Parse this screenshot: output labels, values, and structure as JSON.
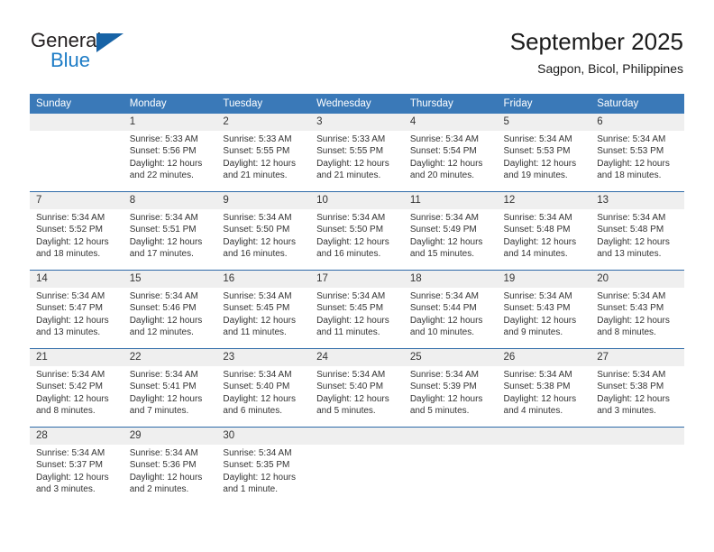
{
  "brand": {
    "name_top": "General",
    "name_bottom": "Blue",
    "triangle_color": "#1763a6",
    "blue_color": "#1d7cc6"
  },
  "header": {
    "title": "September 2025",
    "subtitle": "Sagpon, Bicol, Philippines"
  },
  "theme": {
    "header_blue": "#3a79b8",
    "divider_blue": "#2e6aa8",
    "daynum_band": "#efefef",
    "text": "#333333"
  },
  "weekdays": [
    "Sunday",
    "Monday",
    "Tuesday",
    "Wednesday",
    "Thursday",
    "Friday",
    "Saturday"
  ],
  "weeks": [
    [
      {
        "day": "",
        "sunrise": "",
        "sunset": "",
        "daylight1": "",
        "daylight2": ""
      },
      {
        "day": "1",
        "sunrise": "Sunrise: 5:33 AM",
        "sunset": "Sunset: 5:56 PM",
        "daylight1": "Daylight: 12 hours",
        "daylight2": "and 22 minutes."
      },
      {
        "day": "2",
        "sunrise": "Sunrise: 5:33 AM",
        "sunset": "Sunset: 5:55 PM",
        "daylight1": "Daylight: 12 hours",
        "daylight2": "and 21 minutes."
      },
      {
        "day": "3",
        "sunrise": "Sunrise: 5:33 AM",
        "sunset": "Sunset: 5:55 PM",
        "daylight1": "Daylight: 12 hours",
        "daylight2": "and 21 minutes."
      },
      {
        "day": "4",
        "sunrise": "Sunrise: 5:34 AM",
        "sunset": "Sunset: 5:54 PM",
        "daylight1": "Daylight: 12 hours",
        "daylight2": "and 20 minutes."
      },
      {
        "day": "5",
        "sunrise": "Sunrise: 5:34 AM",
        "sunset": "Sunset: 5:53 PM",
        "daylight1": "Daylight: 12 hours",
        "daylight2": "and 19 minutes."
      },
      {
        "day": "6",
        "sunrise": "Sunrise: 5:34 AM",
        "sunset": "Sunset: 5:53 PM",
        "daylight1": "Daylight: 12 hours",
        "daylight2": "and 18 minutes."
      }
    ],
    [
      {
        "day": "7",
        "sunrise": "Sunrise: 5:34 AM",
        "sunset": "Sunset: 5:52 PM",
        "daylight1": "Daylight: 12 hours",
        "daylight2": "and 18 minutes."
      },
      {
        "day": "8",
        "sunrise": "Sunrise: 5:34 AM",
        "sunset": "Sunset: 5:51 PM",
        "daylight1": "Daylight: 12 hours",
        "daylight2": "and 17 minutes."
      },
      {
        "day": "9",
        "sunrise": "Sunrise: 5:34 AM",
        "sunset": "Sunset: 5:50 PM",
        "daylight1": "Daylight: 12 hours",
        "daylight2": "and 16 minutes."
      },
      {
        "day": "10",
        "sunrise": "Sunrise: 5:34 AM",
        "sunset": "Sunset: 5:50 PM",
        "daylight1": "Daylight: 12 hours",
        "daylight2": "and 16 minutes."
      },
      {
        "day": "11",
        "sunrise": "Sunrise: 5:34 AM",
        "sunset": "Sunset: 5:49 PM",
        "daylight1": "Daylight: 12 hours",
        "daylight2": "and 15 minutes."
      },
      {
        "day": "12",
        "sunrise": "Sunrise: 5:34 AM",
        "sunset": "Sunset: 5:48 PM",
        "daylight1": "Daylight: 12 hours",
        "daylight2": "and 14 minutes."
      },
      {
        "day": "13",
        "sunrise": "Sunrise: 5:34 AM",
        "sunset": "Sunset: 5:48 PM",
        "daylight1": "Daylight: 12 hours",
        "daylight2": "and 13 minutes."
      }
    ],
    [
      {
        "day": "14",
        "sunrise": "Sunrise: 5:34 AM",
        "sunset": "Sunset: 5:47 PM",
        "daylight1": "Daylight: 12 hours",
        "daylight2": "and 13 minutes."
      },
      {
        "day": "15",
        "sunrise": "Sunrise: 5:34 AM",
        "sunset": "Sunset: 5:46 PM",
        "daylight1": "Daylight: 12 hours",
        "daylight2": "and 12 minutes."
      },
      {
        "day": "16",
        "sunrise": "Sunrise: 5:34 AM",
        "sunset": "Sunset: 5:45 PM",
        "daylight1": "Daylight: 12 hours",
        "daylight2": "and 11 minutes."
      },
      {
        "day": "17",
        "sunrise": "Sunrise: 5:34 AM",
        "sunset": "Sunset: 5:45 PM",
        "daylight1": "Daylight: 12 hours",
        "daylight2": "and 11 minutes."
      },
      {
        "day": "18",
        "sunrise": "Sunrise: 5:34 AM",
        "sunset": "Sunset: 5:44 PM",
        "daylight1": "Daylight: 12 hours",
        "daylight2": "and 10 minutes."
      },
      {
        "day": "19",
        "sunrise": "Sunrise: 5:34 AM",
        "sunset": "Sunset: 5:43 PM",
        "daylight1": "Daylight: 12 hours",
        "daylight2": "and 9 minutes."
      },
      {
        "day": "20",
        "sunrise": "Sunrise: 5:34 AM",
        "sunset": "Sunset: 5:43 PM",
        "daylight1": "Daylight: 12 hours",
        "daylight2": "and 8 minutes."
      }
    ],
    [
      {
        "day": "21",
        "sunrise": "Sunrise: 5:34 AM",
        "sunset": "Sunset: 5:42 PM",
        "daylight1": "Daylight: 12 hours",
        "daylight2": "and 8 minutes."
      },
      {
        "day": "22",
        "sunrise": "Sunrise: 5:34 AM",
        "sunset": "Sunset: 5:41 PM",
        "daylight1": "Daylight: 12 hours",
        "daylight2": "and 7 minutes."
      },
      {
        "day": "23",
        "sunrise": "Sunrise: 5:34 AM",
        "sunset": "Sunset: 5:40 PM",
        "daylight1": "Daylight: 12 hours",
        "daylight2": "and 6 minutes."
      },
      {
        "day": "24",
        "sunrise": "Sunrise: 5:34 AM",
        "sunset": "Sunset: 5:40 PM",
        "daylight1": "Daylight: 12 hours",
        "daylight2": "and 5 minutes."
      },
      {
        "day": "25",
        "sunrise": "Sunrise: 5:34 AM",
        "sunset": "Sunset: 5:39 PM",
        "daylight1": "Daylight: 12 hours",
        "daylight2": "and 5 minutes."
      },
      {
        "day": "26",
        "sunrise": "Sunrise: 5:34 AM",
        "sunset": "Sunset: 5:38 PM",
        "daylight1": "Daylight: 12 hours",
        "daylight2": "and 4 minutes."
      },
      {
        "day": "27",
        "sunrise": "Sunrise: 5:34 AM",
        "sunset": "Sunset: 5:38 PM",
        "daylight1": "Daylight: 12 hours",
        "daylight2": "and 3 minutes."
      }
    ],
    [
      {
        "day": "28",
        "sunrise": "Sunrise: 5:34 AM",
        "sunset": "Sunset: 5:37 PM",
        "daylight1": "Daylight: 12 hours",
        "daylight2": "and 3 minutes."
      },
      {
        "day": "29",
        "sunrise": "Sunrise: 5:34 AM",
        "sunset": "Sunset: 5:36 PM",
        "daylight1": "Daylight: 12 hours",
        "daylight2": "and 2 minutes."
      },
      {
        "day": "30",
        "sunrise": "Sunrise: 5:34 AM",
        "sunset": "Sunset: 5:35 PM",
        "daylight1": "Daylight: 12 hours",
        "daylight2": "and 1 minute."
      },
      {
        "day": "",
        "sunrise": "",
        "sunset": "",
        "daylight1": "",
        "daylight2": ""
      },
      {
        "day": "",
        "sunrise": "",
        "sunset": "",
        "daylight1": "",
        "daylight2": ""
      },
      {
        "day": "",
        "sunrise": "",
        "sunset": "",
        "daylight1": "",
        "daylight2": ""
      },
      {
        "day": "",
        "sunrise": "",
        "sunset": "",
        "daylight1": "",
        "daylight2": ""
      }
    ]
  ]
}
